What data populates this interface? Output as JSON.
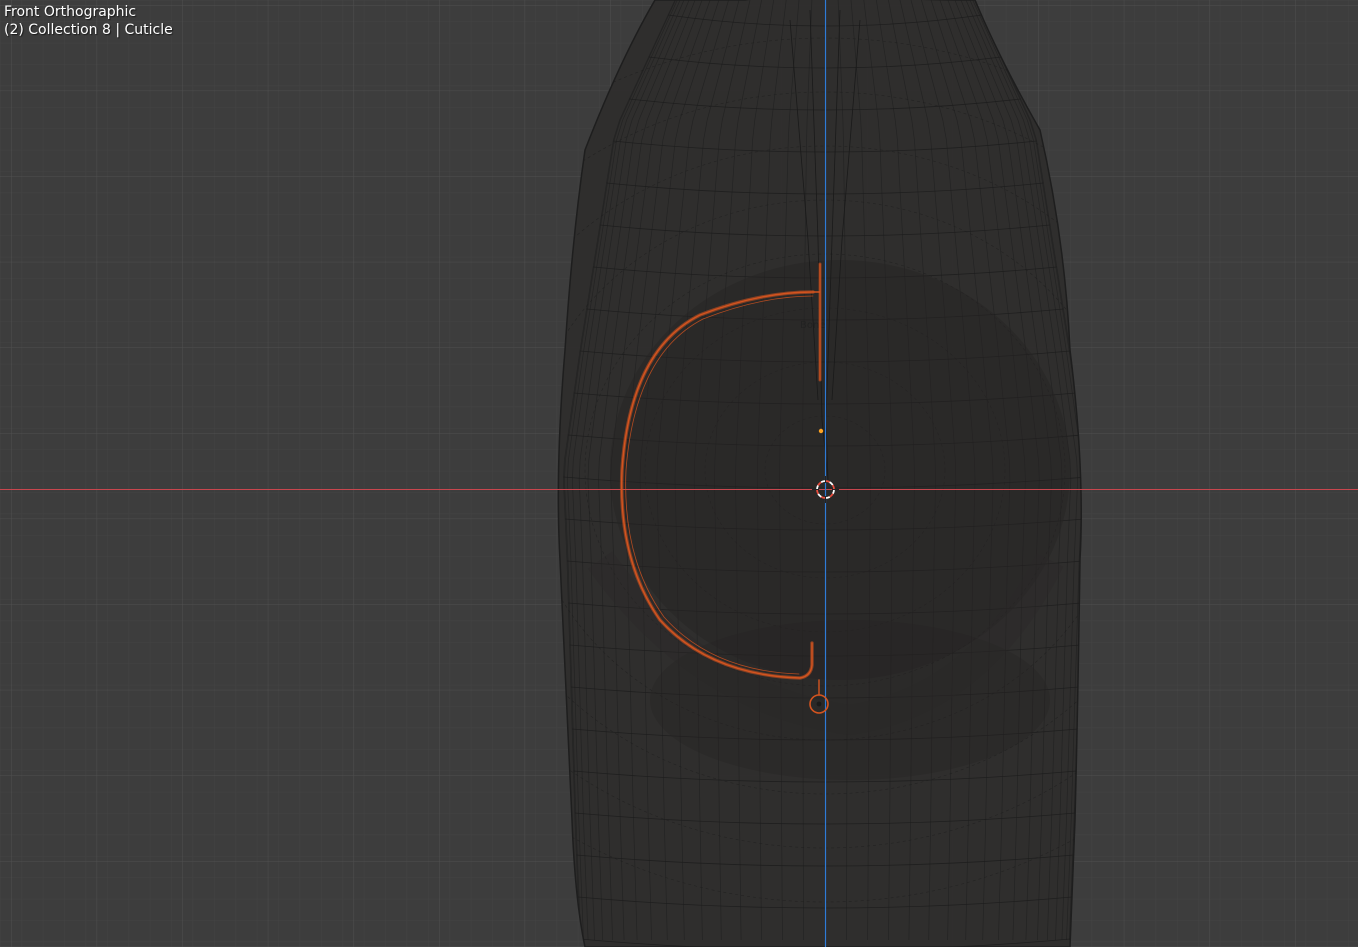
{
  "viewport": {
    "view_name": "Front Orthographic",
    "collection_info": "(2) Collection 8 | Cuticle"
  },
  "colors": {
    "background": "#3d3d3d",
    "grid_minor": "#434343",
    "grid_major": "#4f4f4f",
    "x_axis": "#c8464e",
    "z_axis": "#2f7bd6",
    "mesh_fill": "#2e2c2b",
    "wireframe": "#1e1e1e",
    "selected_curve": "#d4541f",
    "origin_point": "#ffa321",
    "cursor_red": "#e84c3d"
  },
  "icons": {
    "cursor": "3d-cursor-icon",
    "origin": "object-origin-icon"
  }
}
